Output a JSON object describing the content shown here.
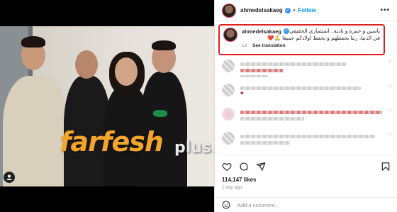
{
  "post": {
    "username": "ahmedelsakaeg",
    "follow_label": "Follow",
    "more_label": "•••"
  },
  "caption": {
    "username": "ahmedelsakaeg",
    "text_line1": "ياسين و حمزة و نادية.. استثماري الحقيقي",
    "text_line2": "في الدنيا، ربنا يحفظهم و يحفظ اولادكم جميعا 🙏❤️",
    "age": "1d",
    "see_translation": "See translation"
  },
  "watermark": {
    "brand": "farfesh",
    "suffix": "plus.com"
  },
  "comments": [
    {
      "reply": true
    },
    {
      "reply": false
    },
    {
      "reply": true
    },
    {
      "reply": false
    }
  ],
  "stats": {
    "likes": "114,147 likes",
    "age": "1 day ago"
  },
  "composer": {
    "placeholder": "Add a comment..."
  },
  "colors": {
    "accent": "#0095f6",
    "highlight_border": "#e02020",
    "watermark": "#f4a42a"
  },
  "icons": [
    "verified-icon",
    "more-icon",
    "heart-icon",
    "comment-icon",
    "share-icon",
    "bookmark-icon",
    "emoji-icon",
    "tag-user-icon"
  ]
}
